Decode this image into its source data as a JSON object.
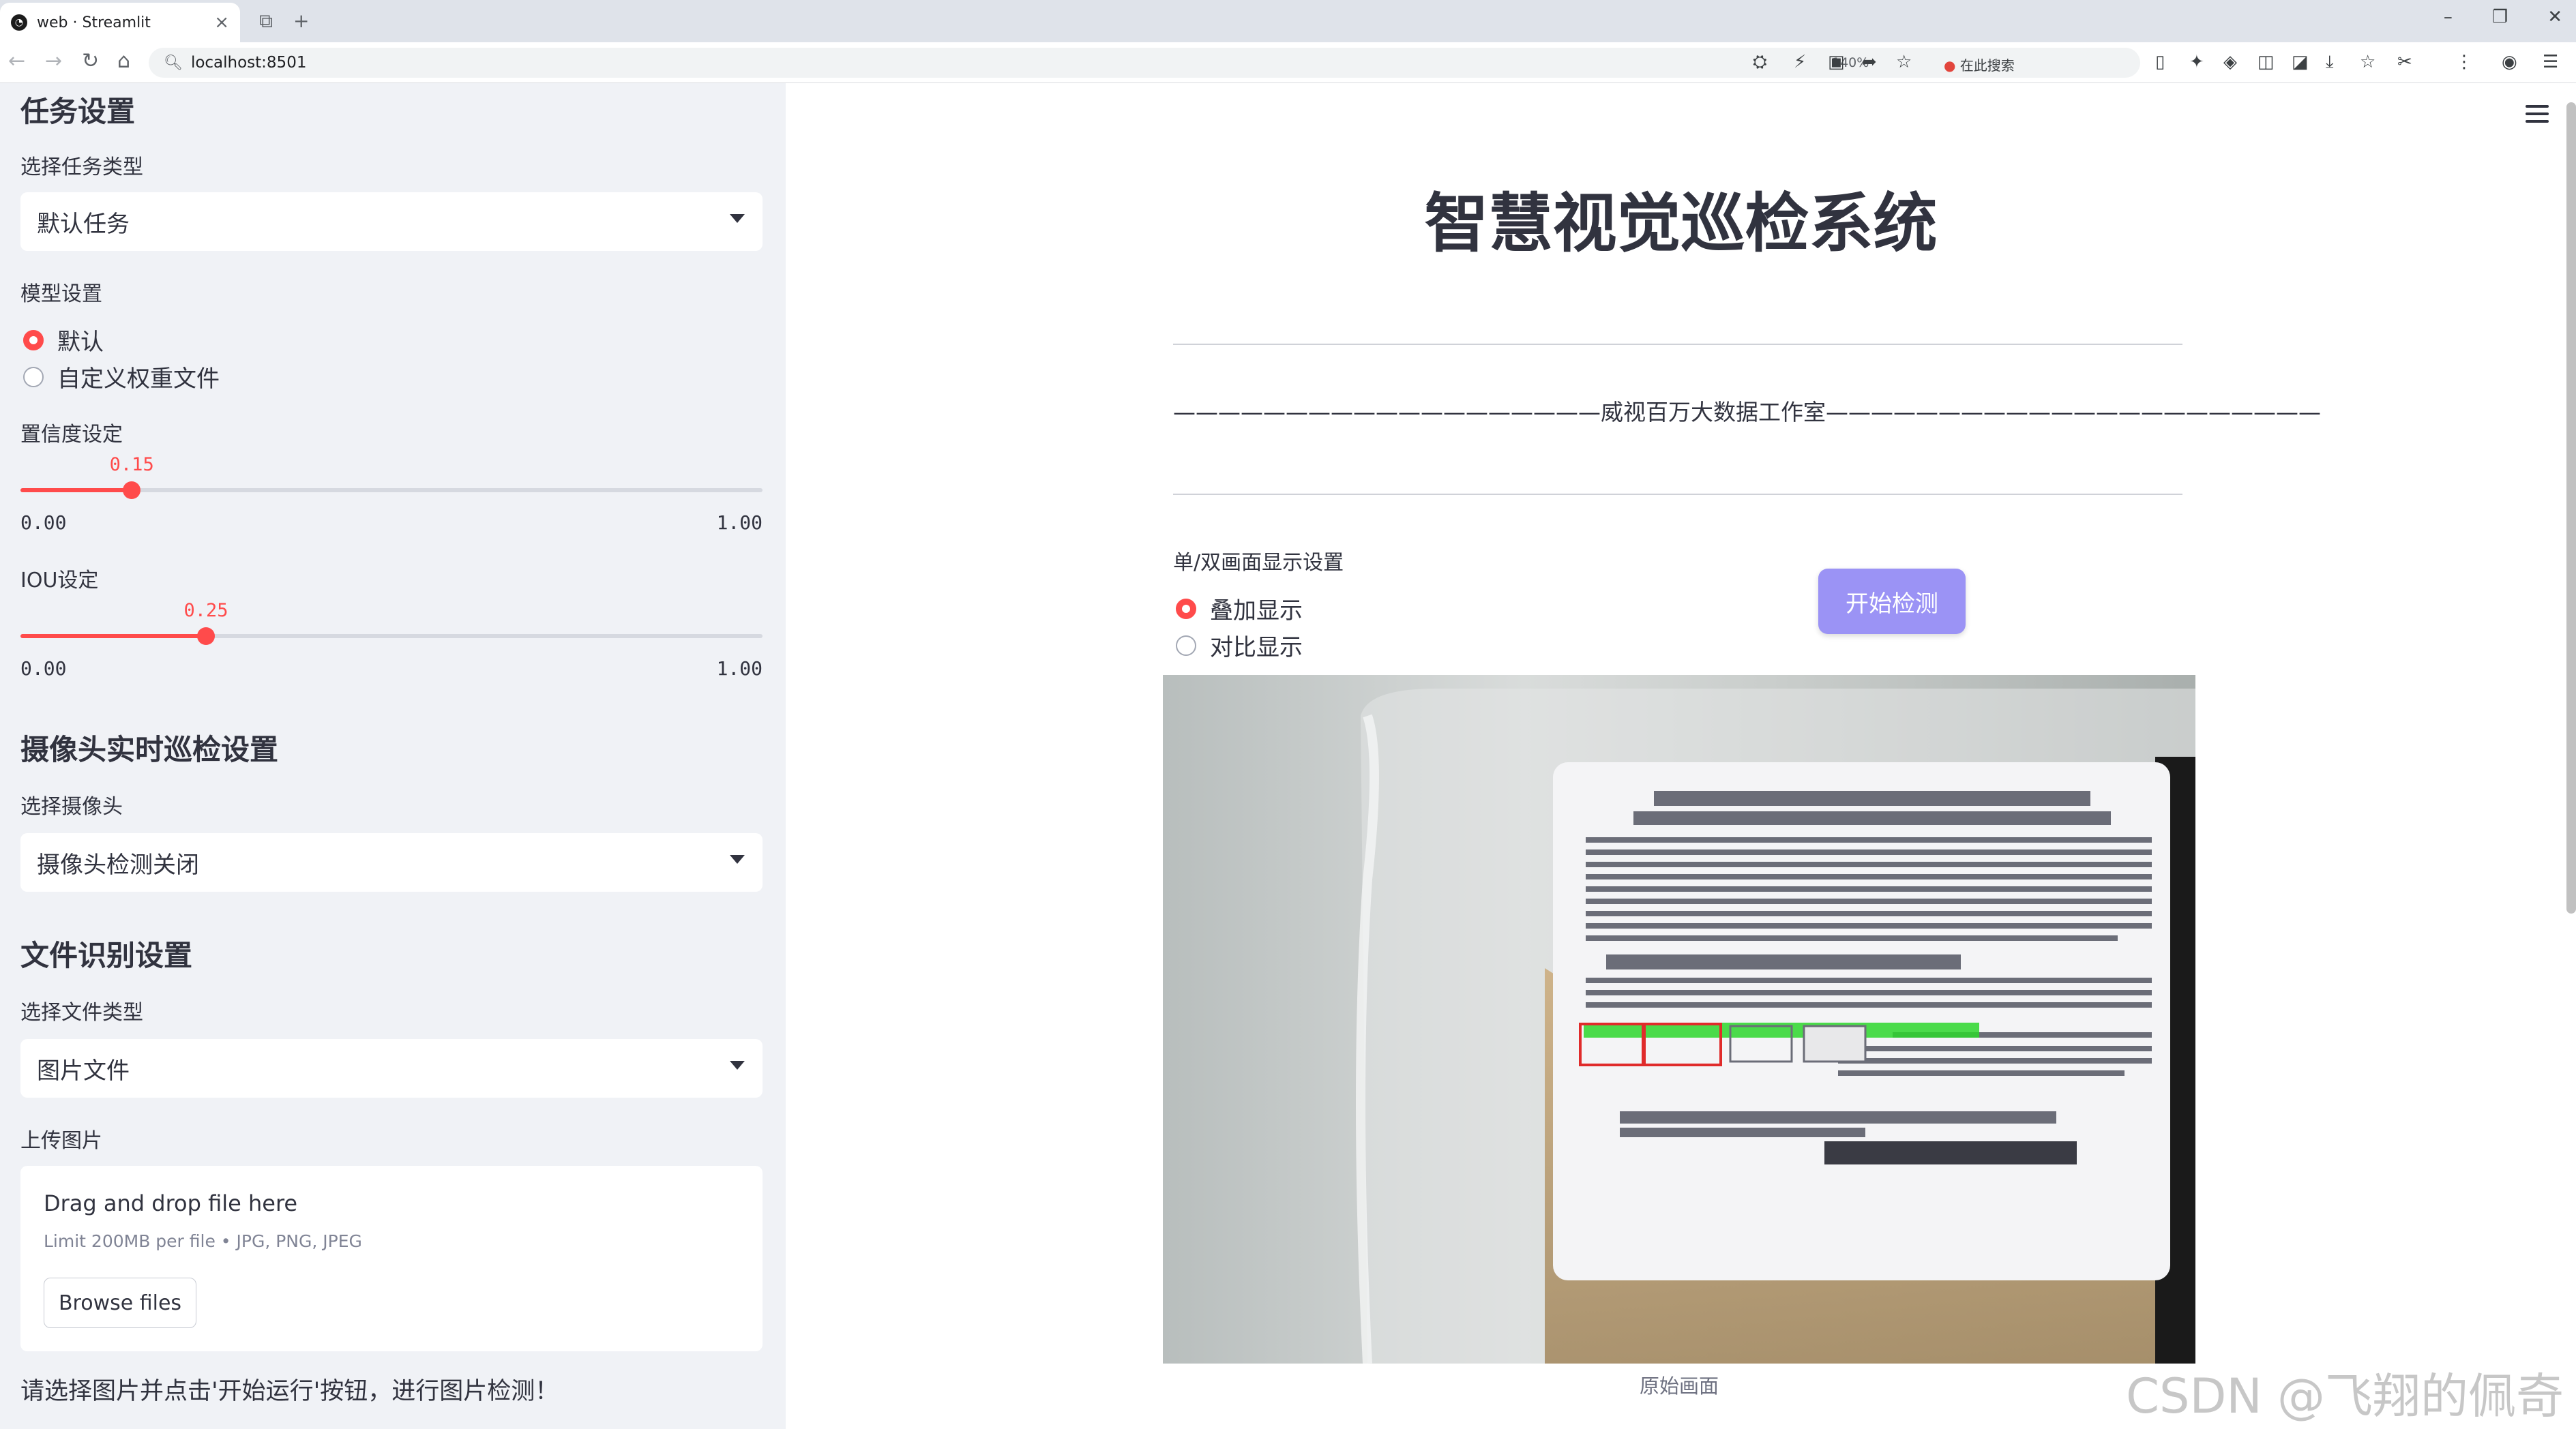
{
  "browser": {
    "tab_title": "web · Streamlit",
    "address": "localhost:8501",
    "zoom": "140%",
    "search_label": "在此搜索"
  },
  "sidebar": {
    "task_section_title": "任务设置",
    "task_type_label": "选择任务类型",
    "task_type_value": "默认任务",
    "model_label": "模型设置",
    "model_options": [
      "默认",
      "自定义权重文件"
    ],
    "confidence_label": "置信度设定",
    "confidence": {
      "value": 0.15,
      "value_text": "0.15",
      "min": "0.00",
      "max": "1.00"
    },
    "iou_label": "IOU设定",
    "iou": {
      "value": 0.25,
      "value_text": "0.25",
      "min": "0.00",
      "max": "1.00"
    },
    "camera_section_title": "摄像头实时巡检设置",
    "camera_label": "选择摄像头",
    "camera_value": "摄像头检测关闭",
    "file_section_title": "文件识别设置",
    "file_type_label": "选择文件类型",
    "file_type_value": "图片文件",
    "upload_label": "上传图片",
    "uploader_title": "Drag and drop file here",
    "uploader_limit": "Limit 200MB per file • JPG, PNG, JPEG",
    "browse_label": "Browse files",
    "hint": "请选择图片并点击'开始运行'按钮，进行图片检测！"
  },
  "main": {
    "title": "智慧视觉巡检系统",
    "studio_line": "———————————————————威视百万大数据工作室——————————————————————",
    "display_label": "单/双画面显示设置",
    "display_options": [
      "叠加显示",
      "对比显示"
    ],
    "start_button": "开始检测",
    "image_caption": "原始画面",
    "watermark": "CSDN @飞翔的佩奇"
  },
  "colors": {
    "accent": "#ff4b4b",
    "button": "#9b93f5",
    "sidebar_bg": "#f0f2f6"
  }
}
